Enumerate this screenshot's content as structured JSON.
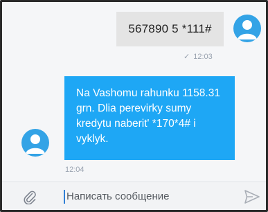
{
  "conversation": {
    "outgoing": {
      "text": "567890 5 *111#",
      "time": "12:03",
      "status_icon": "check-icon"
    },
    "incoming": {
      "text": "Na Vashomu rahunku 1158.31 grn. Dlia perevirky sumy kredytu naberit' *170*4# i vyklyk.",
      "time": "12:04"
    }
  },
  "composer": {
    "placeholder": "Написать сообщение",
    "attach_icon": "paperclip-icon",
    "send_icon": "send-icon"
  },
  "colors": {
    "incoming_bubble": "#1ea7f5",
    "outgoing_bubble": "#e4e4e4",
    "avatar": "#33a3e6",
    "meta_text": "#9aa3b0"
  }
}
